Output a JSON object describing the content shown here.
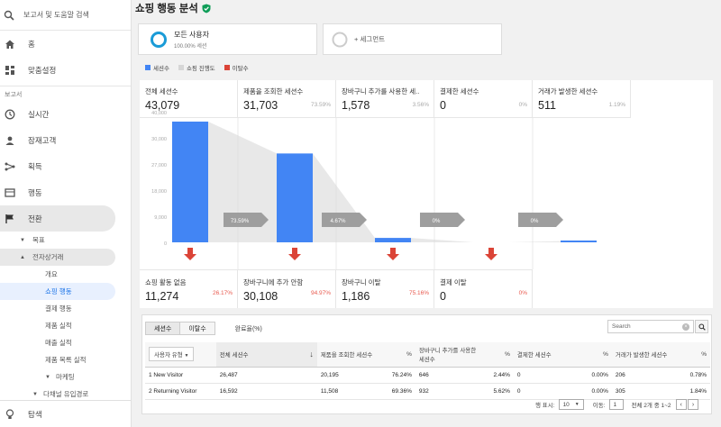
{
  "sidebar": {
    "search_label": "보고서 및 도움말 검색",
    "home": "홈",
    "custom": "맞춤설정",
    "reports_section": "보고서",
    "realtime": "실시간",
    "audience": "잠재고객",
    "acquisition": "획득",
    "behavior": "행동",
    "conversions": "전환",
    "goals": "목표",
    "ecommerce": "전자상거래",
    "overview": "개요",
    "shopping_behavior": "쇼핑 행동",
    "checkout_behavior": "결제 행동",
    "product_performance": "제품 실적",
    "sales_performance": "매출 실적",
    "product_list": "제품 목록 실적",
    "marketing": "마케팅",
    "multichannel": "다채널 유입경로",
    "discover": "탐색"
  },
  "header": {
    "title": "쇼핑 행동 분석"
  },
  "segments": {
    "all_users": "모든 사용자",
    "all_users_pct": "100.00% 세션",
    "add_segment": "+ 세그먼트"
  },
  "legend": {
    "sessions": "세션수",
    "abandon": "쇼핑 진행도",
    "exit": "이탈수"
  },
  "legend_colors": {
    "sessions": "#4285f4",
    "abandon": "#d6d6d6",
    "exit": "#db4437"
  },
  "funnel": {
    "yticks": [
      "40,000",
      "30,000",
      "27,000",
      "18,000",
      "9,000",
      "0"
    ],
    "steps": [
      {
        "label": "전체 세션수",
        "value": "43,079",
        "pct": "",
        "arrow": "73.59%"
      },
      {
        "label": "제품을 조회한 세션수",
        "value": "31,703",
        "pct": "73.59%",
        "arrow": "4.67%"
      },
      {
        "label": "장바구니 추가를 사용한 세...",
        "value": "1,578",
        "pct": "3.56%",
        "arrow": "0%"
      },
      {
        "label": "결제한 세션수",
        "value": "0",
        "pct": "0%",
        "arrow": "0%"
      },
      {
        "label": "거래가 발생한 세션수",
        "value": "511",
        "pct": "1.19%",
        "arrow": ""
      }
    ],
    "abandon": [
      {
        "label": "쇼핑 활동 없음",
        "value": "11,274",
        "pct": "26.17%"
      },
      {
        "label": "장바구니에 추가 안함",
        "value": "30,108",
        "pct": "94.97%"
      },
      {
        "label": "장바구니 이탈",
        "value": "1,186",
        "pct": "75.16%"
      },
      {
        "label": "결제 이탈",
        "value": "0",
        "pct": "0%"
      }
    ]
  },
  "chart_data": {
    "type": "bar",
    "categories": [
      "전체 세션수",
      "제품을 조회한 세션수",
      "장바구니 추가를 사용한 세...",
      "결제한 세션수",
      "거래가 발생한 세션수"
    ],
    "values": [
      43079,
      31703,
      1578,
      0,
      511
    ],
    "ylim": [
      0,
      45000
    ]
  },
  "table": {
    "tabs": [
      "세션수",
      "이탈수"
    ],
    "tab3": "완료율(%)",
    "search_placeholder": "Search",
    "headers": [
      "사용자 유형",
      "전체 세션수",
      "제품을 조회한 세션수",
      "%",
      "장바구니 추가를 사용한 세션수",
      "%",
      "결제한 세션수",
      "%",
      "거래가 발생한 세션수",
      "%"
    ],
    "rows": [
      [
        "1  New Visitor",
        "26,487",
        "20,195",
        "76.24%",
        "646",
        "2.44%",
        "0",
        "0.00%",
        "206",
        "0.78%"
      ],
      [
        "2  Returning Visitor",
        "16,592",
        "11,508",
        "69.36%",
        "932",
        "5.62%",
        "0",
        "0.00%",
        "305",
        "1.84%"
      ]
    ],
    "rows_label": "행 표시:",
    "rows_value": "10",
    "goto_label": "이동:",
    "goto_value": "1",
    "range": "전체 2개 중 1~2"
  }
}
